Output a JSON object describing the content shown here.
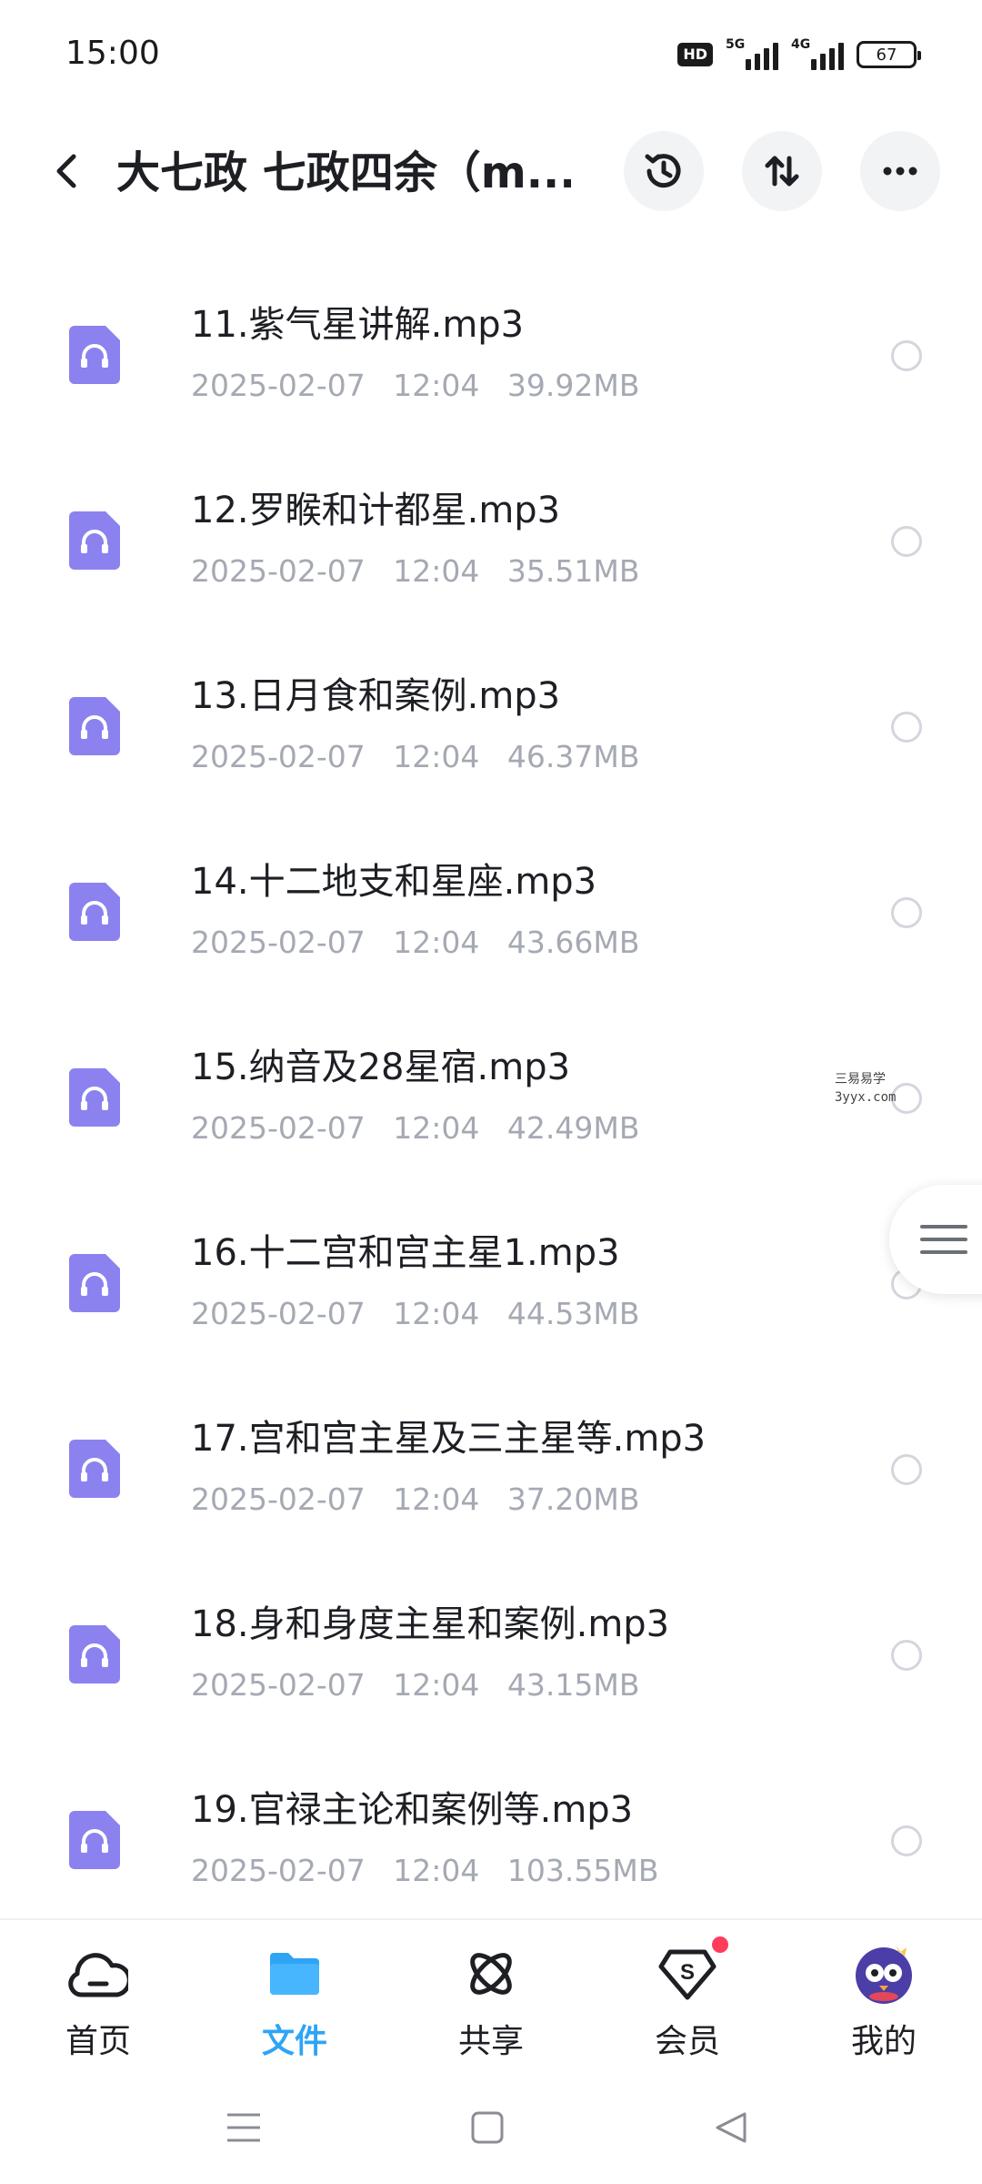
{
  "status_bar": {
    "time": "15:00",
    "hd_label": "HD",
    "sim1_label": "5G",
    "sim2_label": "4G",
    "battery_level": "67"
  },
  "header": {
    "title": "大七政 七政四余（m...",
    "icons": [
      "back-arrow-icon",
      "history-icon",
      "sort-icon",
      "more-icon"
    ]
  },
  "files": [
    {
      "name": "11.紫气星讲解.mp3",
      "date": "2025-02-07",
      "time": "12:04",
      "size": "39.92MB"
    },
    {
      "name": "12.罗睺和计都星.mp3",
      "date": "2025-02-07",
      "time": "12:04",
      "size": "35.51MB"
    },
    {
      "name": "13.日月食和案例.mp3",
      "date": "2025-02-07",
      "time": "12:04",
      "size": "46.37MB"
    },
    {
      "name": "14.十二地支和星座.mp3",
      "date": "2025-02-07",
      "time": "12:04",
      "size": "43.66MB"
    },
    {
      "name": "15.纳音及28星宿.mp3",
      "date": "2025-02-07",
      "time": "12:04",
      "size": "42.49MB"
    },
    {
      "name": "16.十二宫和宫主星1.mp3",
      "date": "2025-02-07",
      "time": "12:04",
      "size": "44.53MB"
    },
    {
      "name": "17.宫和宫主星及三主星等.mp3",
      "date": "2025-02-07",
      "time": "12:04",
      "size": "37.20MB"
    },
    {
      "name": "18.身和身度主星和案例.mp3",
      "date": "2025-02-07",
      "time": "12:04",
      "size": "43.15MB"
    },
    {
      "name": "19.官禄主论和案例等.mp3",
      "date": "2025-02-07",
      "time": "12:04",
      "size": "103.55MB"
    }
  ],
  "watermark": {
    "line1": "三易易学",
    "line2": "3yyx.com"
  },
  "bottom_nav": [
    {
      "label": "首页",
      "icon": "cloud-home-icon",
      "active": false
    },
    {
      "label": "文件",
      "icon": "folder-icon",
      "active": true
    },
    {
      "label": "共享",
      "icon": "share-orbit-icon",
      "active": false
    },
    {
      "label": "会员",
      "icon": "vip-diamond-icon",
      "active": false
    },
    {
      "label": "我的",
      "icon": "avatar-icon",
      "active": false
    }
  ],
  "colors": {
    "accent": "#2ea4f5",
    "file_icon": "#8b82f0",
    "meta_text": "#a5a9b3",
    "badge": "#ff3d5a"
  }
}
